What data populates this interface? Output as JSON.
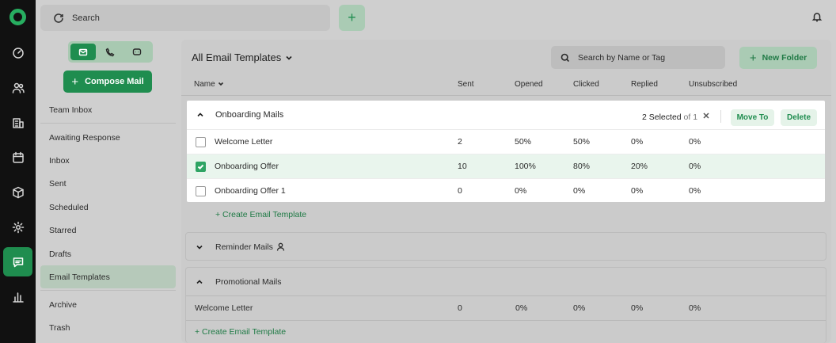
{
  "topbar": {
    "search_label": "Search"
  },
  "rail": {
    "items": [
      "dashboard-icon",
      "users-icon",
      "building-icon",
      "calendar-icon",
      "box-icon",
      "gear-icon",
      "chat-icon",
      "chart-icon"
    ]
  },
  "sidebar": {
    "compose_label": "Compose Mail",
    "items": [
      "Team Inbox",
      "Awaiting Response",
      "Inbox",
      "Sent",
      "Scheduled",
      "Starred",
      "Drafts",
      "Email Templates",
      "Archive",
      "Trash"
    ],
    "active": "Email Templates"
  },
  "panel": {
    "title": "All Email Templates",
    "search_placeholder": "Search by Name or Tag",
    "new_folder_label": "New Folder",
    "columns": [
      "Name",
      "Sent",
      "Opened",
      "Clicked",
      "Replied",
      "Unsubscribed"
    ]
  },
  "groups": {
    "onboarding": {
      "title": "Onboarding Mails",
      "selected_text": "2 Selected",
      "of_text": "of 1",
      "move_label": "Move To",
      "delete_label": "Delete",
      "rows": [
        {
          "name": "Welcome Letter",
          "sent": "2",
          "opened": "50%",
          "clicked": "50%",
          "replied": "0%",
          "unsub": "0%",
          "checked": false
        },
        {
          "name": "Onboarding Offer",
          "sent": "10",
          "opened": "100%",
          "clicked": "80%",
          "replied": "20%",
          "unsub": "0%",
          "checked": true
        },
        {
          "name": "Onboarding Offer 1",
          "sent": "0",
          "opened": "0%",
          "clicked": "0%",
          "replied": "0%",
          "unsub": "0%",
          "checked": false
        }
      ],
      "create_label": "+ Create Email Template"
    },
    "reminder": {
      "title": "Reminder Mails"
    },
    "promotional": {
      "title": "Promotional Mails",
      "row": {
        "name": "Welcome Letter",
        "sent": "0",
        "opened": "0%",
        "clicked": "0%",
        "replied": "0%",
        "unsub": "0%"
      },
      "create_label": "+ Create Email Template"
    }
  },
  "colors": {
    "accent": "#1f8d4f",
    "selected_row": "#e9f5ed"
  }
}
